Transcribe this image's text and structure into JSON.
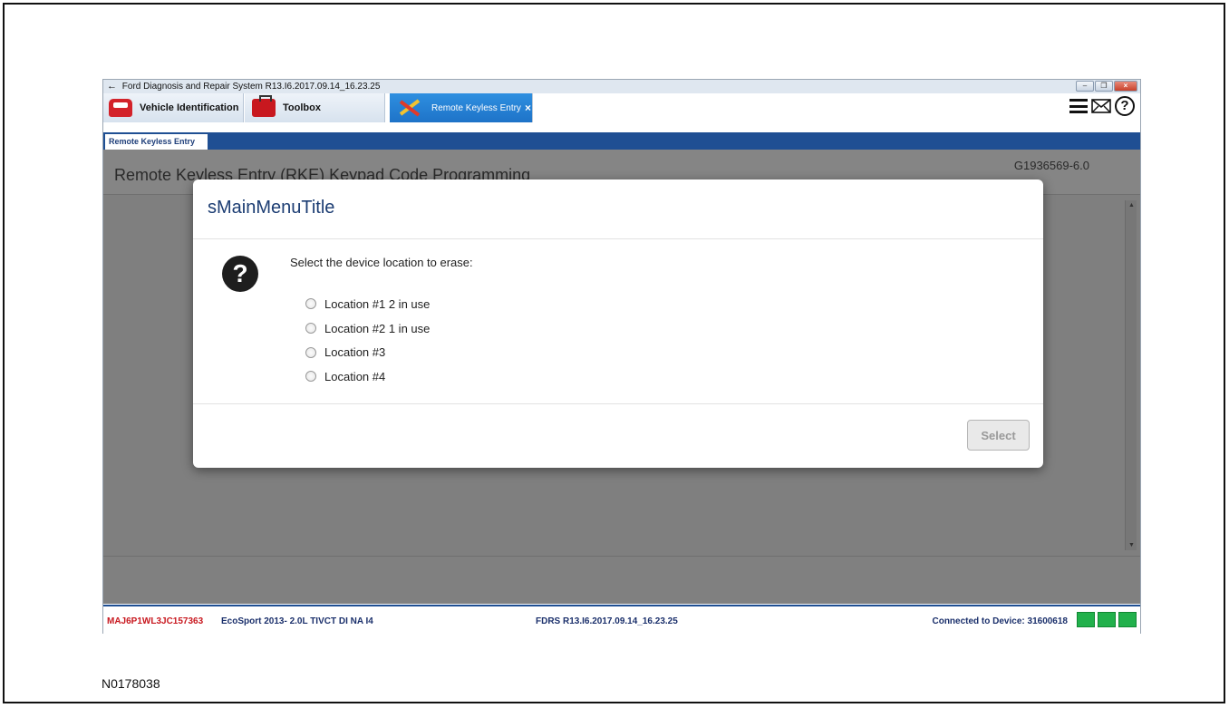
{
  "window": {
    "title": "Ford Diagnosis and Repair System R13.I6.2017.09.14_16.23.25",
    "buttons": [
      "minimize",
      "restore",
      "close"
    ]
  },
  "tabs": [
    {
      "label": "Vehicle Identification",
      "icon": "car-icon"
    },
    {
      "label": "Toolbox",
      "icon": "toolbox-icon"
    },
    {
      "label": "Remote Keyless Entry",
      "icon": "tools-icon",
      "active": true,
      "close": "×"
    }
  ],
  "toolbar_icons": [
    "menu-icon",
    "mail-icon",
    "help-icon"
  ],
  "subtab": {
    "label": "Remote Keyless Entry"
  },
  "content": {
    "title": "Remote Keyless Entry (RKE) Keypad Code Programming",
    "doc_id": "G1936569-6.0"
  },
  "dialog": {
    "title": "sMainMenuTitle",
    "prompt": "Select the device location to erase:",
    "options": [
      "Location #1 2 in use",
      "Location #2 1 in use",
      "Location #3",
      "Location #4"
    ],
    "select_label": "Select"
  },
  "status": {
    "vin": "MAJ6P1WL3JC157363",
    "vehicle": "EcoSport 2013- 2.0L TIVCT DI NA I4",
    "version": "FDRS R13.I6.2017.09.14_16.23.25",
    "connection": "Connected to Device: 31600618"
  },
  "reference": "N0178038",
  "colors": {
    "accent_blue": "#1f4f93",
    "active_tab": "#1e73c8",
    "vin_red": "#c8181f",
    "status_green": "#22b14c"
  }
}
